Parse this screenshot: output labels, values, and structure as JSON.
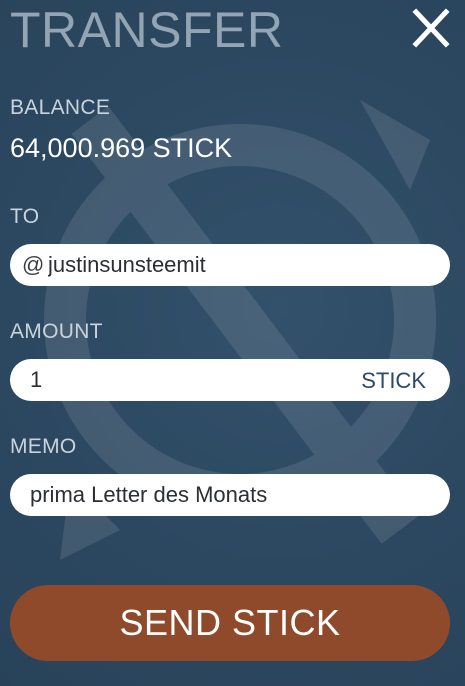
{
  "header": {
    "title": "TRANSFER"
  },
  "balance": {
    "label": "BALANCE",
    "value": "64,000.969 STICK"
  },
  "to": {
    "label": "TO",
    "prefix": "@",
    "value": "justinsunsteemit"
  },
  "amount": {
    "label": "AMOUNT",
    "value": "1",
    "currency": "STICK"
  },
  "memo": {
    "label": "MEMO",
    "value": "prima Letter des Monats"
  },
  "actions": {
    "send_label": "SEND STICK"
  },
  "icons": {
    "close": "close-icon",
    "watermark": "logo-watermark"
  },
  "colors": {
    "background": "#2d4a63",
    "title": "#93a4b3",
    "send_button": "#8f4a2c",
    "field": "#ffffff",
    "currency_text": "#2d4a63"
  }
}
